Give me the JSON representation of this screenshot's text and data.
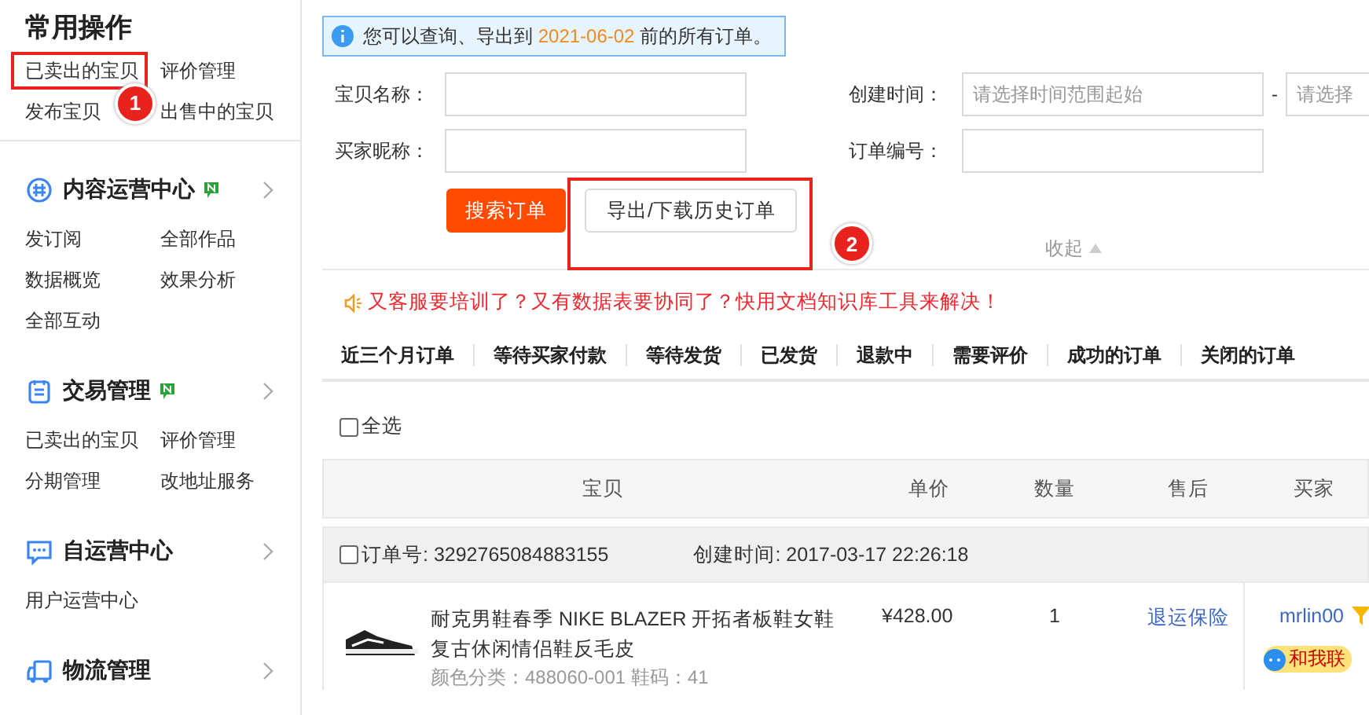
{
  "sidebar": {
    "title": "常用操作",
    "links": [
      {
        "label": "已卖出的宝贝",
        "badge": "1"
      },
      {
        "label": "评价管理"
      },
      {
        "label": "发布宝贝"
      },
      {
        "label": "出售中的宝贝"
      }
    ],
    "groups": [
      {
        "title": "内容运营中心",
        "new": true,
        "links": [
          "发订阅",
          "全部作品",
          "数据概览",
          "效果分析",
          "全部互动"
        ]
      },
      {
        "title": "交易管理",
        "new": true,
        "links": [
          "已卖出的宝贝",
          "评价管理",
          "分期管理",
          "改地址服务"
        ]
      },
      {
        "title": "自运营中心",
        "new": false,
        "links": [
          "用户运营中心"
        ]
      },
      {
        "title": "物流管理",
        "new": false
      }
    ]
  },
  "notice": {
    "prefix": "您可以查询、导出到",
    "date": "2021-06-02",
    "suffix": "前的所有订单。"
  },
  "form": {
    "fields": [
      {
        "label": "宝贝名称：",
        "kind": "text"
      },
      {
        "label": "创建时间：",
        "kind": "range",
        "placeholder": "请选择时间范围起始",
        "separator": "-",
        "placeholder_end": "请选择"
      },
      {
        "label": "买家昵称：",
        "kind": "text"
      },
      {
        "label": "订单编号：",
        "kind": "text"
      }
    ],
    "buttons": [
      {
        "label": "搜索订单",
        "kind": "primary"
      },
      {
        "label": "导出/下载历史订单",
        "kind": "default",
        "badge": "2"
      }
    ],
    "collapse": "收起"
  },
  "promo": "又客服要培训了？又有数据表要协同了？快用文档知识库工具来解决！",
  "tabs": [
    "近三个月订单",
    "等待买家付款",
    "等待发货",
    "已发货",
    "退款中",
    "需要评价",
    "成功的订单",
    "关闭的订单"
  ],
  "select_all": {
    "label": "全选",
    "checked": false
  },
  "table": {
    "columns": [
      "宝贝",
      "单价",
      "数量",
      "售后",
      "买家"
    ],
    "orders": [
      {
        "checked": false,
        "order_no": "订单号: 3292765084883155",
        "created": "创建时间: 2017-03-17 22:26:18",
        "item": {
          "title": "耐克男鞋春季 NIKE BLAZER 开拓者板鞋女鞋复古休闲情侣鞋反毛皮",
          "spec": "颜色分类：488060-001  鞋码：41",
          "price": "¥428.00",
          "qty": "1",
          "after_sale": "退运保险",
          "buyer": "mrlin00",
          "contact": "和我联"
        }
      }
    ]
  }
}
